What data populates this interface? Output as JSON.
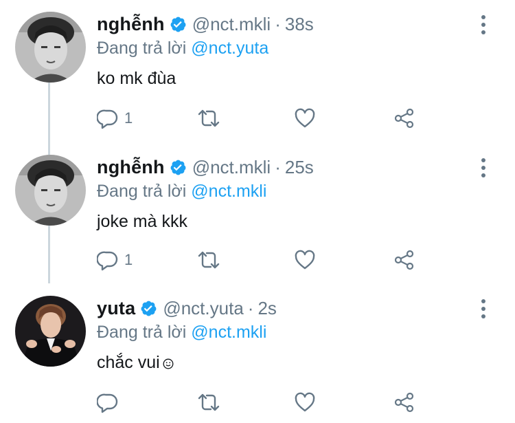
{
  "thread": {
    "tweets": [
      {
        "display_name": "nghễnh",
        "handle": "@nct.mkli",
        "separator": "·",
        "time": "38s",
        "reply_prefix": "Đang trả lời",
        "reply_to": "@nct.yuta",
        "text": "ko mk đùa",
        "reply_count": "1",
        "avatar_icon": "avatar-grayscale-portrait"
      },
      {
        "display_name": "nghễnh",
        "handle": "@nct.mkli",
        "separator": "·",
        "time": "25s",
        "reply_prefix": "Đang trả lời",
        "reply_to": "@nct.mkli",
        "text": "joke mà kkk",
        "reply_count": "1",
        "avatar_icon": "avatar-grayscale-portrait"
      },
      {
        "display_name": "yuta",
        "handle": "@nct.yuta",
        "separator": "·",
        "time": "2s",
        "reply_prefix": "Đang trả lời",
        "reply_to": "@nct.mkli",
        "text": "chắc vui",
        "text_suffix_icon": "smile-emoji-icon",
        "reply_count": "",
        "avatar_icon": "avatar-dark-portrait"
      }
    ]
  },
  "colors": {
    "text_primary": "#14171a",
    "text_secondary": "#657786",
    "link_blue": "#1da1f2",
    "verified_blue": "#1da1f2",
    "icon_gray": "#657786",
    "thread_line": "#ccd6dd"
  },
  "icons": {
    "verified": "verified-badge-icon",
    "more": "more-vertical-icon",
    "reply": "reply-icon",
    "retweet": "retweet-icon",
    "like": "heart-icon",
    "share": "share-icon"
  }
}
